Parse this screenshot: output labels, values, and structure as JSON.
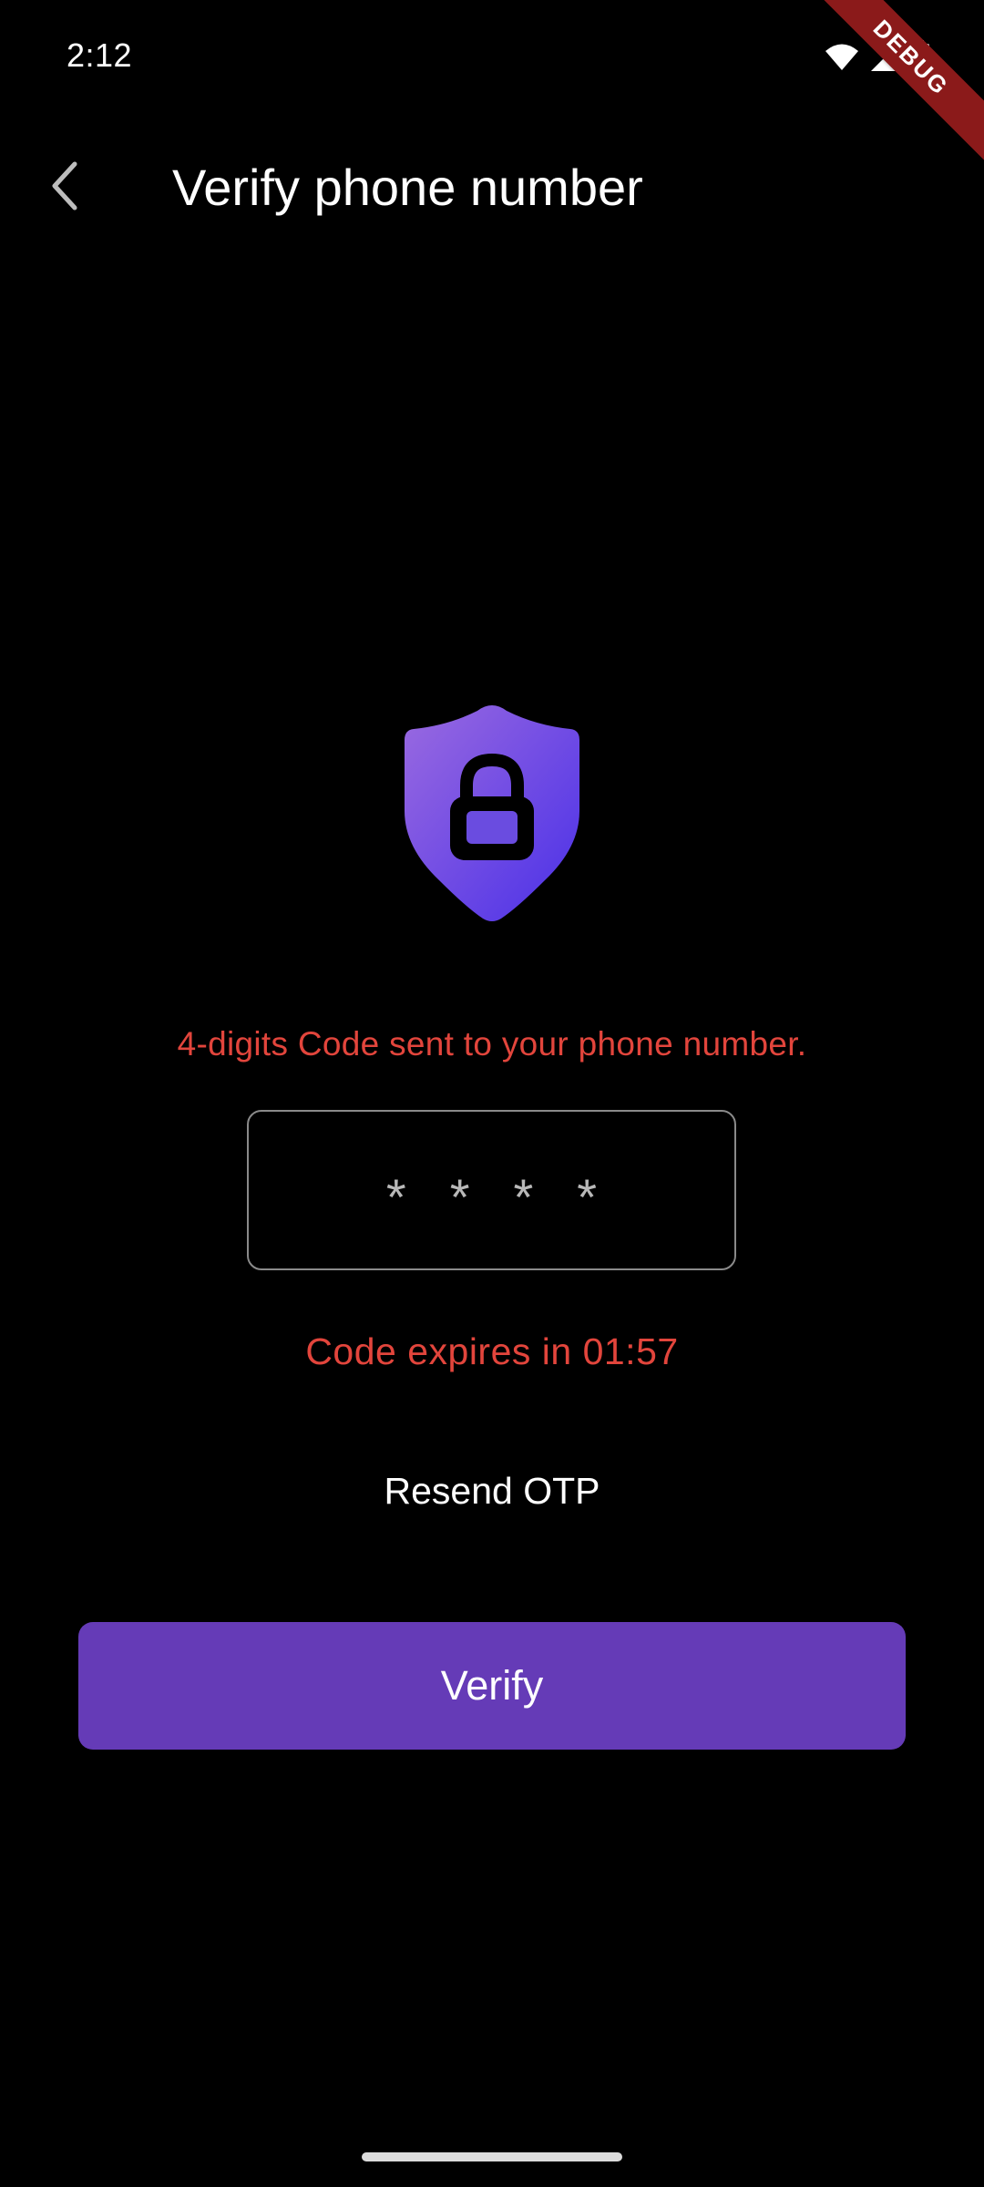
{
  "status_bar": {
    "time": "2:12",
    "icons": [
      "wifi-icon",
      "signal-icon",
      "battery-icon"
    ]
  },
  "debug_banner": "DEBUG",
  "app_bar": {
    "back_icon": "chevron-left-icon",
    "title": "Verify phone number"
  },
  "hero": {
    "icon": "shield-lock-icon",
    "gradient_start": "#9a6ae0",
    "gradient_end": "#4a30e8"
  },
  "info_text": "4-digits Code sent to your phone number.",
  "otp": {
    "placeholder": "****",
    "value": ""
  },
  "expiry_text": "Code expires in 01:57",
  "resend_label": "Resend OTP",
  "verify_label": "Verify",
  "colors": {
    "background": "#000000",
    "accent": "#653bb7",
    "error_text": "#e2453c",
    "debug_ribbon": "#8b1a1a"
  }
}
